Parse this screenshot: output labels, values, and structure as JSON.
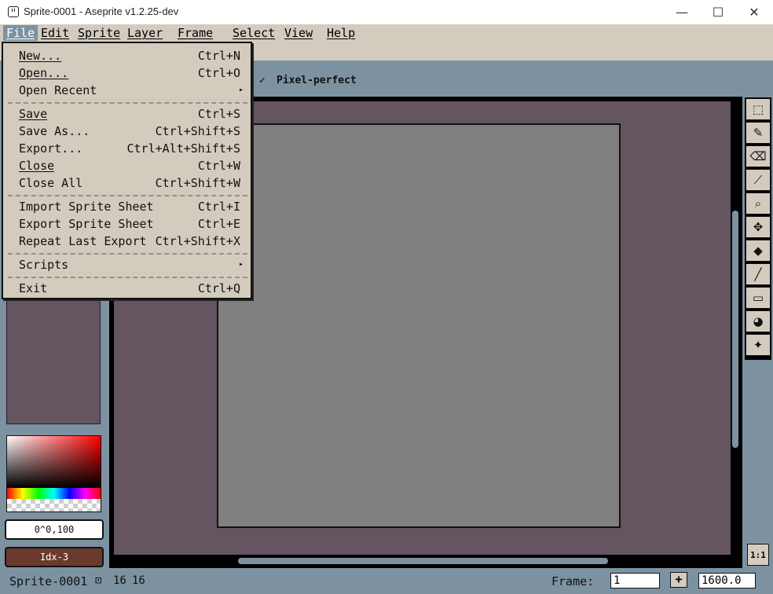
{
  "window": {
    "title": "Sprite-0001 - Aseprite v1.2.25-dev",
    "minimize_glyph": "—",
    "maximize_glyph": "☐",
    "close_glyph": "✕"
  },
  "menubar": {
    "items": [
      "File",
      "Edit",
      "Sprite",
      "Layer",
      "Frame",
      "Select",
      "View",
      "Help"
    ]
  },
  "context_bar": {
    "pixel_perfect_check": "✓",
    "pixel_perfect_label": "Pixel-perfect"
  },
  "file_menu": {
    "new": {
      "label": "New...",
      "shortcut": "Ctrl+N"
    },
    "open": {
      "label": "Open...",
      "shortcut": "Ctrl+O"
    },
    "open_recent": {
      "label": "Open Recent",
      "arrow": "▸"
    },
    "save": {
      "label": "Save",
      "shortcut": "Ctrl+S"
    },
    "save_as": {
      "label": "Save As...",
      "shortcut": "Ctrl+Shift+S"
    },
    "export": {
      "label": "Export...",
      "shortcut": "Ctrl+Alt+Shift+S"
    },
    "close": {
      "label": "Close",
      "shortcut": "Ctrl+W"
    },
    "close_all": {
      "label": "Close All",
      "shortcut": "Ctrl+Shift+W"
    },
    "import_sprite_sheet": {
      "label": "Import Sprite Sheet",
      "shortcut": "Ctrl+I"
    },
    "export_sprite_sheet": {
      "label": "Export Sprite Sheet",
      "shortcut": "Ctrl+E"
    },
    "repeat_last_export": {
      "label": "Repeat Last Export",
      "shortcut": "Ctrl+Shift+X"
    },
    "scripts": {
      "label": "Scripts",
      "arrow": "▸"
    },
    "exit": {
      "label": "Exit",
      "shortcut": "Ctrl+Q"
    }
  },
  "color_panel": {
    "fg_color_value": "0^0,100",
    "bg_color_value": "Idx-3"
  },
  "tools": {
    "icons": [
      "marquee-icon",
      "pencil-icon",
      "eraser-icon",
      "eyedropper-icon",
      "zoom-icon",
      "move-icon",
      "paint-bucket-icon",
      "line-icon",
      "rectangle-icon",
      "contour-icon",
      "blur-icon"
    ],
    "glyphs": [
      "⬚",
      "✎",
      "⌫",
      "⟋",
      "⌕",
      "✥",
      "◆",
      "╱",
      "▭",
      "◕",
      "✦"
    ],
    "one_to_one_label": "1:1"
  },
  "status_bar": {
    "sprite_name": "Sprite-0001",
    "size_icon": "⊡",
    "width": "16",
    "height": "16",
    "frame_label": "Frame:",
    "frame_value": "1",
    "add_frame": "+",
    "zoom_value": "1600.0"
  },
  "colors": {
    "ui_face": "#d3cbbe",
    "workspace": "#7d92a1",
    "editor_bg": "#645560",
    "canvas": "#808080"
  }
}
